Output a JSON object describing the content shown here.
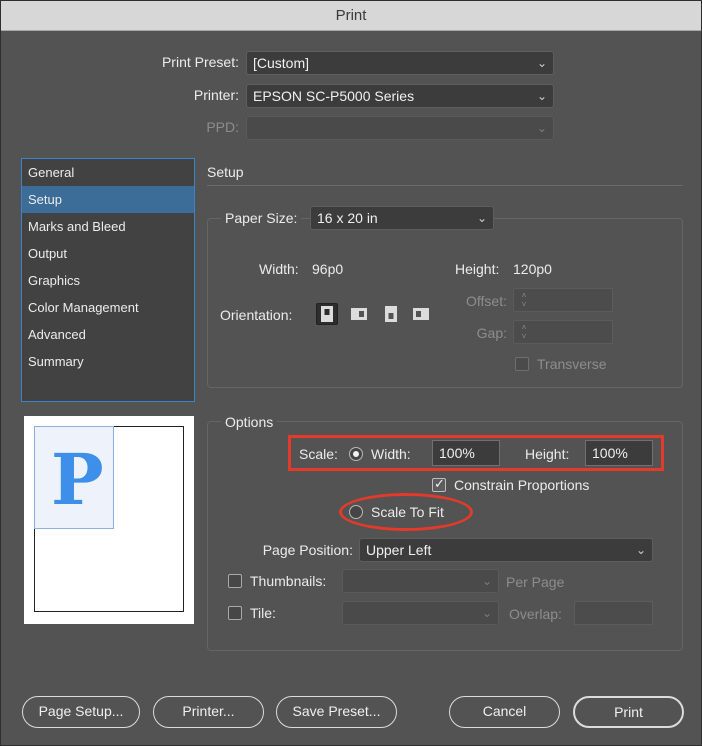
{
  "window": {
    "title": "Print"
  },
  "header": {
    "print_preset_label": "Print Preset:",
    "print_preset_value": "[Custom]",
    "printer_label": "Printer:",
    "printer_value": "EPSON SC-P5000 Series",
    "ppd_label": "PPD:",
    "ppd_value": ""
  },
  "sidebar": {
    "items": [
      {
        "label": "General"
      },
      {
        "label": "Setup",
        "selected": true
      },
      {
        "label": "Marks and Bleed"
      },
      {
        "label": "Output"
      },
      {
        "label": "Graphics"
      },
      {
        "label": "Color Management"
      },
      {
        "label": "Advanced"
      },
      {
        "label": "Summary"
      }
    ]
  },
  "preview": {
    "glyph": "P"
  },
  "setup": {
    "section_title": "Setup",
    "paper_size_label": "Paper Size:",
    "paper_size_value": "16 x 20 in",
    "width_label": "Width:",
    "width_value": "96p0",
    "height_label": "Height:",
    "height_value": "120p0",
    "orientation_label": "Orientation:",
    "orientation_icons": [
      "portrait-icon",
      "landscape-icon",
      "reverse-portrait-icon",
      "reverse-landscape-icon"
    ],
    "offset_label": "Offset:",
    "gap_label": "Gap:",
    "transverse_label": "Transverse"
  },
  "options": {
    "section_title": "Options",
    "scale_label": "Scale:",
    "width_label": "Width:",
    "width_value": "100%",
    "height_label": "Height:",
    "height_value": "100%",
    "constrain_label": "Constrain Proportions",
    "constrain_checked": true,
    "scale_to_fit_label": "Scale To Fit",
    "page_position_label": "Page Position:",
    "page_position_value": "Upper Left",
    "thumbnails_label": "Thumbnails:",
    "per_page_label": "Per Page",
    "tile_label": "Tile:",
    "overlap_label": "Overlap:"
  },
  "footer": {
    "page_setup": "Page Setup...",
    "printer": "Printer...",
    "save_preset": "Save Preset...",
    "cancel": "Cancel",
    "print": "Print"
  },
  "colors": {
    "dialog_bg": "#535353",
    "selection": "#3c6c98",
    "annotation": "#e23a2b"
  }
}
